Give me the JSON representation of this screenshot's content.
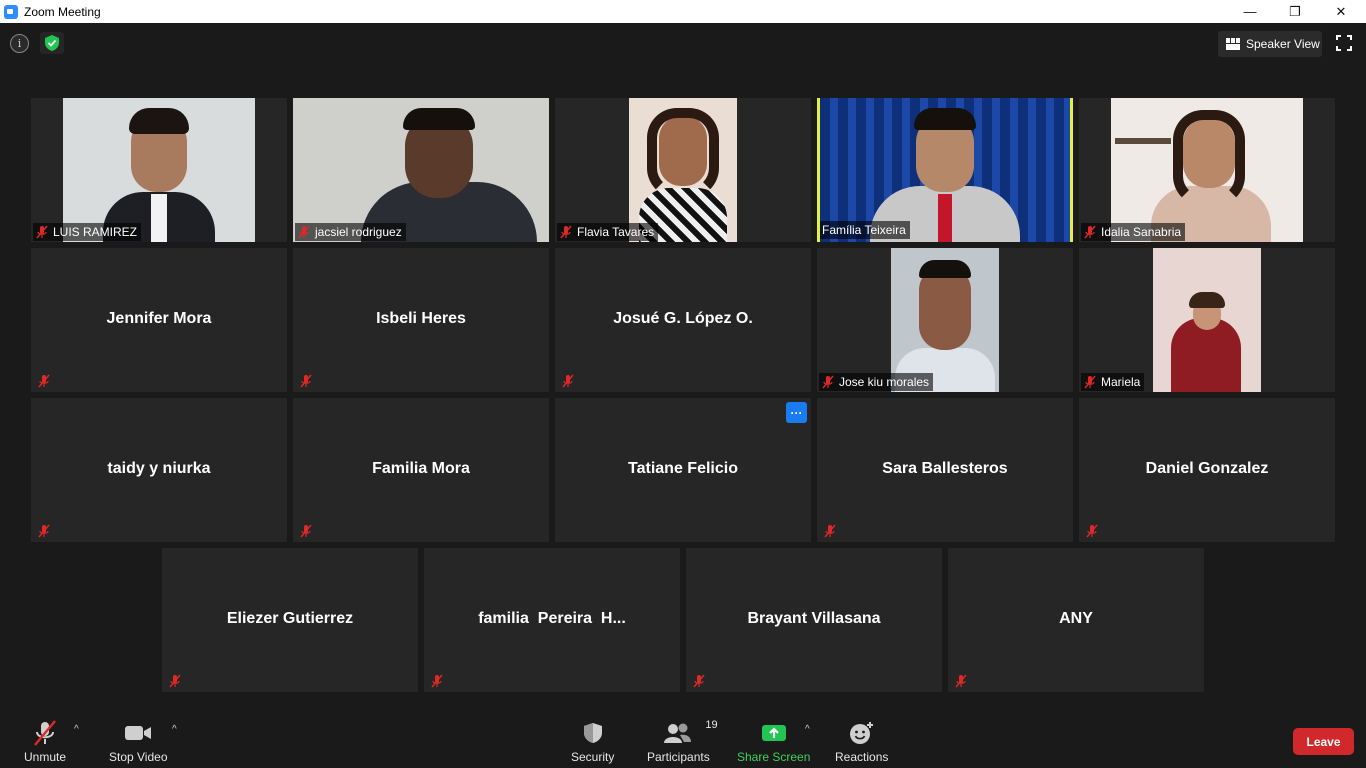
{
  "window": {
    "title": "Zoom Meeting",
    "minimize_glyph": "—",
    "maximize_glyph": "❐",
    "close_glyph": "✕"
  },
  "top": {
    "info_glyph": "i",
    "view_label": "Speaker View"
  },
  "tiles": {
    "t0": "LUIS RAMIREZ",
    "t1": "jacsiel rodriguez",
    "t2": "Flavia Tavares",
    "t3": "Família Teixeira",
    "t4": "Idalia Sanabria",
    "t5": "Jennifer Mora",
    "t6": "Isbeli Heres",
    "t7": "Josué G. López O.",
    "t8": "Jose kiu morales",
    "t9": "Mariela",
    "t10": "taidy y niurka",
    "t11": "Familia Mora",
    "t12": "Tatiane Felicio",
    "t13": "Sara Ballesteros",
    "t14": "Daniel Gonzalez",
    "t15": "Eliezer Gutierrez",
    "t16": "familia  Pereira  H...",
    "t17": "Brayant Villasana",
    "t18": "ANY"
  },
  "more_glyph": "···",
  "toolbar": {
    "unmute": "Unmute",
    "stop_video": "Stop Video",
    "security": "Security",
    "participants": "Participants",
    "participants_count": "19",
    "share_screen": "Share Screen",
    "reactions": "Reactions",
    "leave": "Leave",
    "caret": "^"
  },
  "colors": {
    "accent_green": "#3fcf5a",
    "leave_red": "#d1282b",
    "active_border": "#e6ef3c",
    "more_blue": "#1a7cf2",
    "mute_red": "#e02828"
  },
  "icons": [
    "info-icon",
    "shield-check-icon",
    "grid-icon",
    "fullscreen-icon",
    "mic-muted-icon",
    "camera-icon",
    "shield-icon",
    "participants-icon",
    "share-screen-icon",
    "reactions-icon",
    "chevron-up-icon"
  ]
}
